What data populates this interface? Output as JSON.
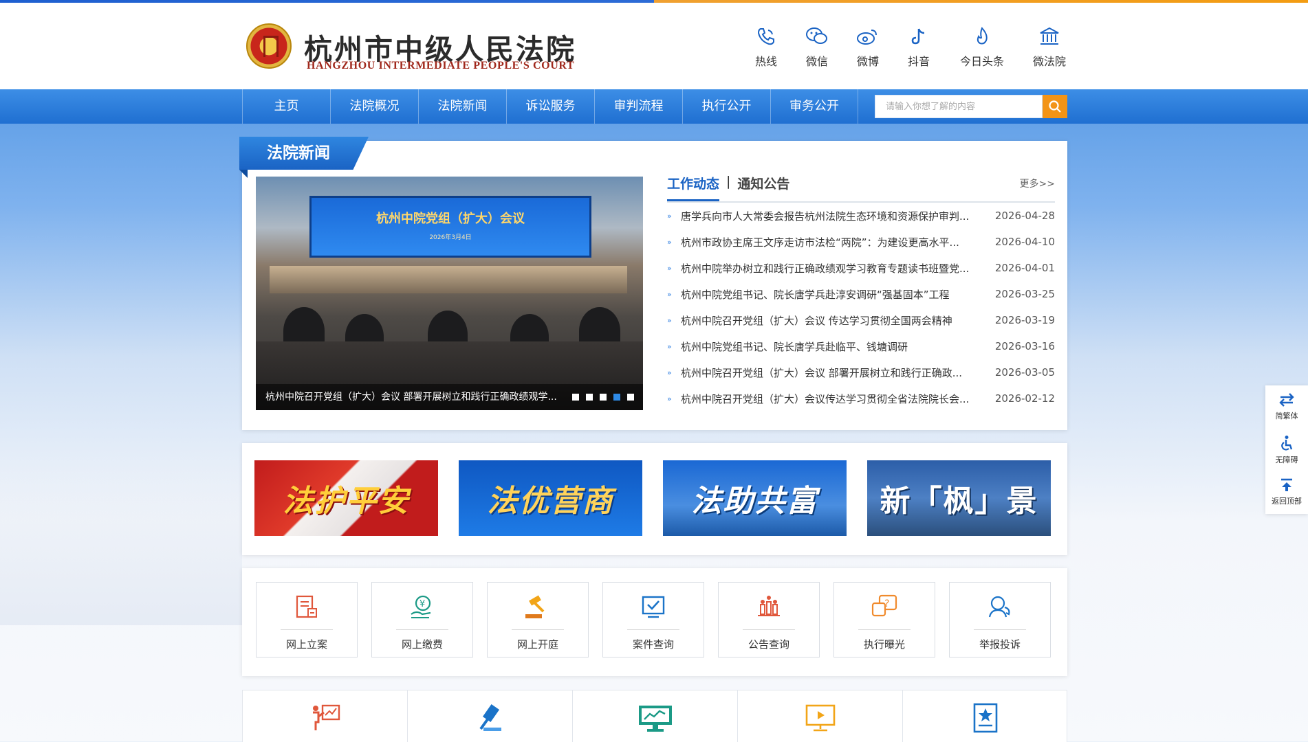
{
  "header": {
    "title": "杭州市中级人民法院",
    "subtitle": "HANGZHOU INTERMEDIATE PEOPLE'S COURT",
    "social": [
      {
        "label": "热线",
        "icon": "phone-icon"
      },
      {
        "label": "微信",
        "icon": "wechat-icon"
      },
      {
        "label": "微博",
        "icon": "weibo-icon"
      },
      {
        "label": "抖音",
        "icon": "douyin-icon"
      },
      {
        "label": "今日头条",
        "icon": "toutiao-icon"
      },
      {
        "label": "微法院",
        "icon": "court-building-icon"
      }
    ]
  },
  "nav": {
    "items": [
      "主页",
      "法院概况",
      "法院新闻",
      "诉讼服务",
      "审判流程",
      "执行公开",
      "审务公开"
    ],
    "search_placeholder": "请输入你想了解的内容"
  },
  "news": {
    "section_title": "法院新闻",
    "slide": {
      "screen_title": "杭州中院党组（扩大）会议",
      "screen_date": "2026年3月4日",
      "caption": "杭州中院召开党组（扩大）会议 部署开展树立和践行正确政绩观学...",
      "dots": 5,
      "active_dot": 4
    },
    "tabs": {
      "active": "工作动态",
      "separator": "|",
      "other": "通知公告",
      "more": "更多>>"
    },
    "items": [
      {
        "title": "唐学兵向市人大常委会报告杭州法院生态环境和资源保护审判...",
        "date": "2026-04-28"
      },
      {
        "title": "杭州市政协主席王文序走访市法检“两院”：为建设更高水平...",
        "date": "2026-04-10"
      },
      {
        "title": "杭州中院举办树立和践行正确政绩观学习教育专题读书班暨党...",
        "date": "2026-04-01"
      },
      {
        "title": "杭州中院党组书记、院长唐学兵赴淳安调研“强基固本”工程",
        "date": "2026-03-25"
      },
      {
        "title": "杭州中院召开党组（扩大）会议 传达学习贯彻全国两会精神",
        "date": "2026-03-19"
      },
      {
        "title": "杭州中院党组书记、院长唐学兵赴临平、钱塘调研",
        "date": "2026-03-16"
      },
      {
        "title": "杭州中院召开党组（扩大）会议 部署开展树立和践行正确政...",
        "date": "2026-03-05"
      },
      {
        "title": "杭州中院召开党组（扩大）会议传达学习贯彻全省法院院长会...",
        "date": "2026-02-12"
      }
    ]
  },
  "banners": [
    "法护平安",
    "法优营商",
    "法助共富",
    "新「枫」景"
  ],
  "services": [
    {
      "label": "网上立案",
      "icon": "online-filing-icon"
    },
    {
      "label": "网上缴费",
      "icon": "online-payment-icon"
    },
    {
      "label": "网上开庭",
      "icon": "online-hearing-icon"
    },
    {
      "label": "案件查询",
      "icon": "case-query-icon"
    },
    {
      "label": "公告查询",
      "icon": "notice-query-icon"
    },
    {
      "label": "执行曝光",
      "icon": "execution-exposure-icon"
    },
    {
      "label": "举报投诉",
      "icon": "report-complaint-icon"
    }
  ],
  "bottom_icons": [
    "presenter-chart-icon",
    "gavel-icon",
    "monitor-chart-icon",
    "video-screen-icon",
    "star-document-icon"
  ],
  "sidebar": {
    "items": [
      {
        "label": "简繁体",
        "icon": "swap-icon"
      },
      {
        "label": "无障碍",
        "icon": "accessibility-icon"
      },
      {
        "label": "返回顶部",
        "icon": "back-to-top-icon"
      }
    ]
  },
  "colors": {
    "primary_blue": "#1f6fd1",
    "accent_orange": "#f39416",
    "court_red": "#a0281c"
  }
}
